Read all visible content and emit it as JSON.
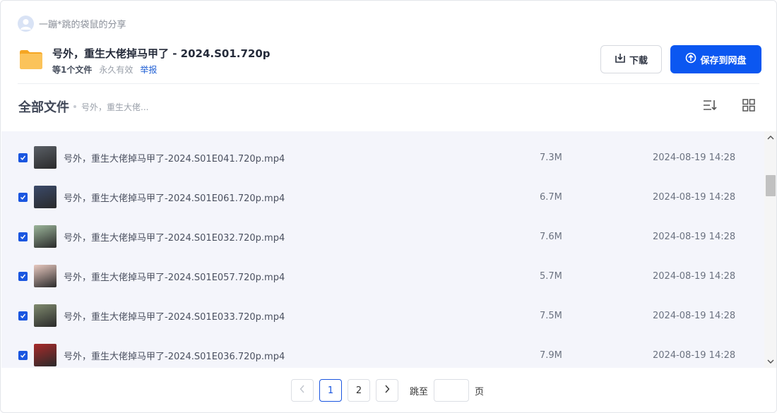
{
  "sharer": {
    "name": "一蹦*跳的袋鼠的分享",
    "avatar_icon": "user-icon"
  },
  "share": {
    "title": "号外，重生大佬掉马甲了 - 2024.S01.720p",
    "file_count": "等1个文件",
    "validity": "永久有效",
    "report": "举报",
    "folder_icon": "folder-icon",
    "folder_color": "#f7b84b"
  },
  "actions": {
    "download_label": "下载",
    "save_label": "保存到网盘",
    "accent_color": "#0b57f1"
  },
  "browser": {
    "all_files_label": "全部文件",
    "breadcrumb": "号外，重生大佬...",
    "sort_icon": "sort-icon",
    "grid_icon": "grid-view-icon"
  },
  "files": [
    {
      "name": "号外，重生大佬掉马甲了-2024.S01E041.720p.mp4",
      "size": "7.3M",
      "date": "2024-08-19 14:28",
      "checked": true,
      "thumb_color": "#5a5f66"
    },
    {
      "name": "号外，重生大佬掉马甲了-2024.S01E061.720p.mp4",
      "size": "6.7M",
      "date": "2024-08-19 14:28",
      "checked": true,
      "thumb_color": "#3b4a6a"
    },
    {
      "name": "号外，重生大佬掉马甲了-2024.S01E032.720p.mp4",
      "size": "7.6M",
      "date": "2024-08-19 14:28",
      "checked": true,
      "thumb_color": "#9bb59a"
    },
    {
      "name": "号外，重生大佬掉马甲了-2024.S01E057.720p.mp4",
      "size": "5.7M",
      "date": "2024-08-19 14:28",
      "checked": true,
      "thumb_color": "#e8c9c0"
    },
    {
      "name": "号外，重生大佬掉马甲了-2024.S01E033.720p.mp4",
      "size": "7.5M",
      "date": "2024-08-19 14:28",
      "checked": true,
      "thumb_color": "#7f8a6e"
    },
    {
      "name": "号外，重生大佬掉马甲了-2024.S01E036.720p.mp4",
      "size": "7.9M",
      "date": "2024-08-19 14:28",
      "checked": true,
      "thumb_color": "#a82a2a"
    }
  ],
  "pagination": {
    "prev_icon": "chevron-left-icon",
    "pages": [
      "1",
      "2"
    ],
    "current": "1",
    "next_icon": "chevron-right-icon",
    "jump_label": "跳至",
    "jump_value": "",
    "page_suffix": "页"
  }
}
